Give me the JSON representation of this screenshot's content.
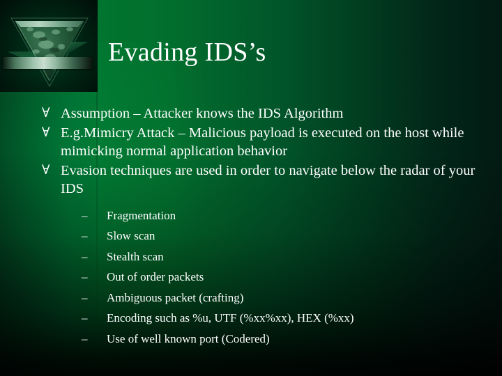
{
  "slide": {
    "title": "Evading IDS’s",
    "colors": {
      "text": "#ffffff",
      "bg_green_bright": "#01742f",
      "bg_green_mid": "#006a30",
      "bg_green_dark": "#013a1c",
      "bg_edge_black": "#021a12",
      "logo_block": "#030d07",
      "logo_bar_highlight": "#c9dfd1"
    },
    "logo": {
      "shape": "inverted-triangle",
      "bar": "horizontal-metal-bar"
    }
  },
  "bullets": [
    {
      "marker": "∀",
      "text": "Assumption – Attacker knows the IDS Algorithm",
      "sub": []
    },
    {
      "marker": "∀",
      "text": "E.g.Mimicry Attack – Malicious payload is executed on the host while mimicking normal application behavior",
      "sub": []
    },
    {
      "marker": "∀",
      "text": "Evasion techniques are used in order to navigate below the radar of your IDS",
      "sub": [
        {
          "marker": "–",
          "text": "Fragmentation"
        },
        {
          "marker": "–",
          "text": "Slow scan"
        },
        {
          "marker": "–",
          "text": "Stealth scan"
        },
        {
          "marker": "–",
          "text": "Out of order packets"
        },
        {
          "marker": "–",
          "text": "Ambiguous packet (crafting)"
        },
        {
          "marker": "–",
          "text": "Encoding such as %u, UTF (%xx%xx), HEX (%xx)"
        },
        {
          "marker": "–",
          "text": "Use of well known port (Codered)"
        }
      ]
    }
  ]
}
